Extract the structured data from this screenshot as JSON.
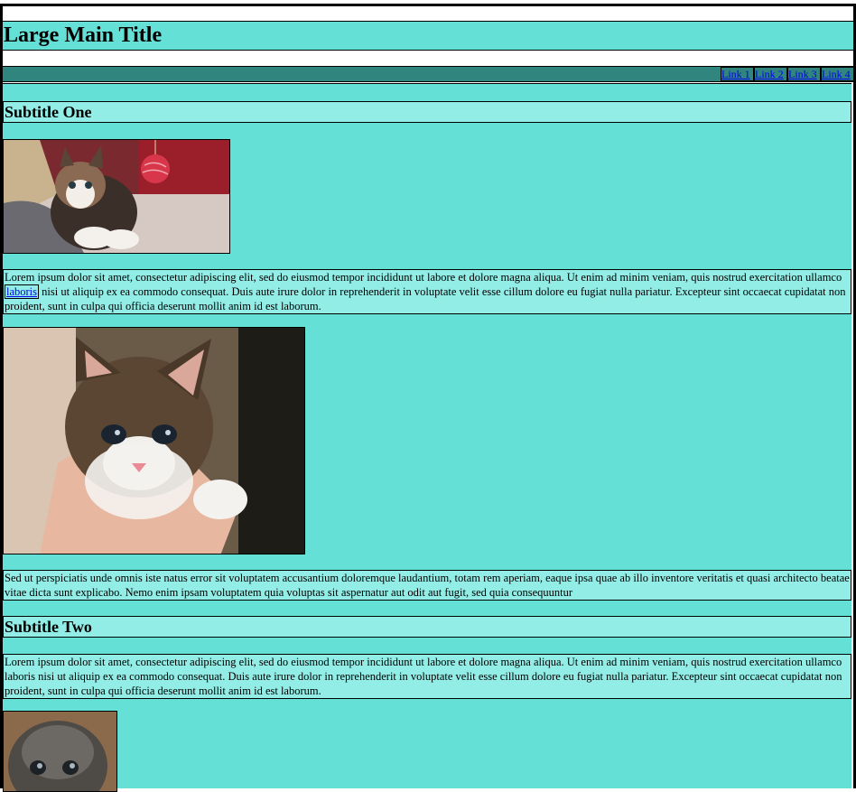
{
  "header": {
    "title": "Large Main Title"
  },
  "nav": {
    "links": [
      "Link 1",
      "Link 2",
      "Link 3",
      "Link 4"
    ]
  },
  "section1": {
    "subtitle": "Subtitle One",
    "image1_alt": "kitten-with-yarn-ball",
    "para1_before": "Lorem ipsum dolor sit amet, consectetur adipiscing elit, sed do eiusmod tempor incididunt ut labore et dolore magna aliqua. Ut enim ad minim veniam, quis nostrud exercitation ullamco ",
    "para1_link": "laboris",
    "para1_after": " nisi ut aliquip ex ea commodo consequat. Duis aute irure dolor in reprehenderit in voluptate velit esse cillum dolore eu fugiat nulla pariatur. Excepteur sint occaecat cupidatat non proident, sunt in culpa qui officia deserunt mollit anim id est laborum.",
    "image2_alt": "kitten-in-hand",
    "para2": "Sed ut perspiciatis unde omnis iste natus error sit voluptatem accusantium doloremque laudantium, totam rem aperiam, eaque ipsa quae ab illo inventore veritatis et quasi architecto beatae vitae dicta sunt explicabo. Nemo enim ipsam voluptatem quia voluptas sit aspernatur aut odit aut fugit, sed quia consequuntur"
  },
  "section2": {
    "subtitle": "Subtitle Two",
    "para1": "Lorem ipsum dolor sit amet, consectetur adipiscing elit, sed do eiusmod tempor incididunt ut labore et dolore magna aliqua. Ut enim ad minim veniam, quis nostrud exercitation ullamco laboris nisi ut aliquip ex ea commodo consequat. Duis aute irure dolor in reprehenderit in voluptate velit esse cillum dolore eu fugiat nulla pariatur. Excepteur sint occaecat cupidatat non proident, sunt in culpa qui officia deserunt mollit anim id est laborum.",
    "image3_alt": "grey-kitten"
  },
  "colors": {
    "header_bg": "#64e0d6",
    "nav_bg": "#31857f",
    "panel_bg": "#92ede6",
    "link": "#0000ee"
  }
}
